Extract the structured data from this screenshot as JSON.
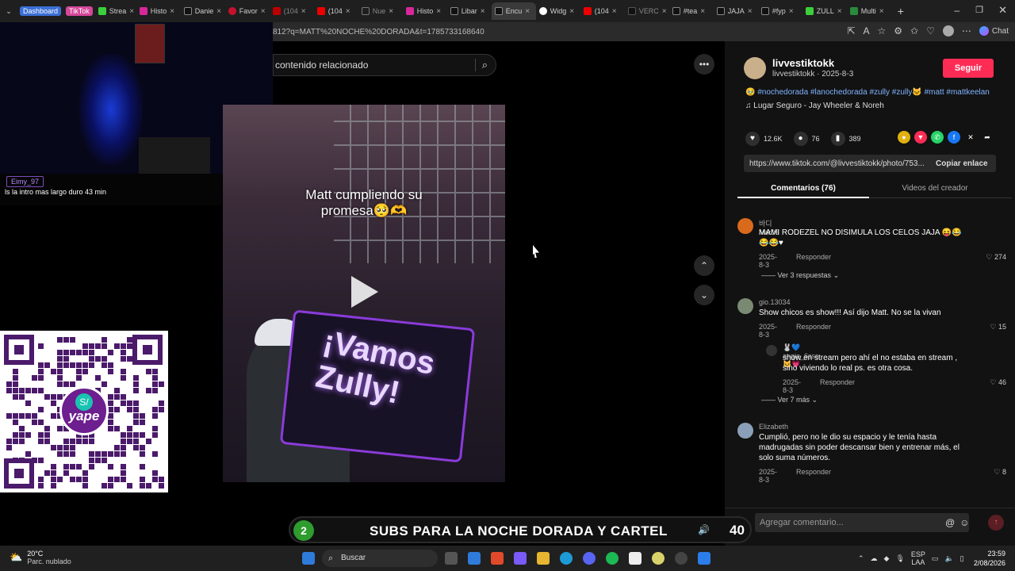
{
  "browser": {
    "group_dashboard": "Dashboard",
    "group_tiktok": "TikTok",
    "tabs": [
      "Strea",
      "Histo",
      "Danie",
      "Favor",
      "(104",
      "(104",
      "Nue",
      "Histo",
      "Libar",
      "Encu",
      "Widg",
      "(104",
      "VERC",
      "#tea",
      "JAJA",
      "#fyp",
      "ZULL",
      "Multi"
    ],
    "active_tab": 9,
    "url": "812?q=MATT%20NOCHE%20DORADA&t=1785733168640",
    "chat_button": "Chat"
  },
  "stream_chat": {
    "username": "Eimy_97",
    "message": "ls la intro mas largo duro 43 min"
  },
  "qr": {
    "brand": "yape",
    "badge": "S/"
  },
  "video": {
    "caption_line1": "Matt cumpliendo su",
    "caption_line2": "promesa🥺🫶",
    "banner_text": "¡Vamos Zully!"
  },
  "search": {
    "text": "contenido relacionado"
  },
  "post": {
    "username": "livvestiktokk",
    "subline": "livvestiktokk · 2025-8-3",
    "follow_label": "Seguir",
    "tags": "🥹 #nochedorada #lanochedorada #zully #zully🐱 #matt #mattkeelan",
    "music": "Lugar Seguro - Jay Wheeler & Noreh",
    "likes": "12.6K",
    "comments": "76",
    "saves": "389",
    "link": "https://www.tiktok.com/@livvestiktokk/photo/753...",
    "copy_label": "Copiar enlace",
    "tab_comments": "Comentarios (76)",
    "tab_creator": "Videos del creador"
  },
  "comments": [
    {
      "name": "바디Mar06",
      "body": "MAMI RODEZEL NO DISIMULA LOS CELOS JAJA 😝😂😂😂♥",
      "date": "2025-8-3",
      "reply": "Responder",
      "likes": "274"
    },
    {
      "name": "gio.13034",
      "body": "Show chicos es show!!! Así dijo Matt. No se la vivan",
      "date": "2025-8-3",
      "reply": "Responder",
      "likes": "15"
    },
    {
      "name": "🐰💙angie_6sss 🐱💗",
      "body": "show en stream pero ahí el no estaba en stream , sino viviendo lo real ps. es otra cosa.",
      "date": "2025-8-3",
      "reply": "Responder",
      "likes": "46"
    },
    {
      "name": "Elizabeth",
      "body": "Cumplió, pero no le dio su espacio y le tenía hasta madrugadas sin poder descansar bien y entrenar más, el solo suma números.",
      "date": "2025-8-3",
      "reply": "Responder",
      "likes": "8"
    }
  ],
  "more_replies_1": "Ver 3 respuestas",
  "more_replies_2": "Ver 7 más",
  "comment_input": {
    "placeholder": "Agregar comentario..."
  },
  "subs_bar": {
    "left_number": "2",
    "text": "SUBS PARA LA NOCHE DORADA Y CARTEL",
    "right_number": "40"
  },
  "taskbar": {
    "temp": "20°C",
    "weather": "Parc. nublado",
    "search": "Buscar",
    "lang1": "ESP",
    "lang2": "LAA",
    "time": "23:59",
    "date": "2/08/2026"
  },
  "colors": {
    "accent": "#fe2c55",
    "tiktok_group": "#d4479a",
    "dashboard_group": "#3b6fd6",
    "subs_green": "#2e9c2e"
  }
}
